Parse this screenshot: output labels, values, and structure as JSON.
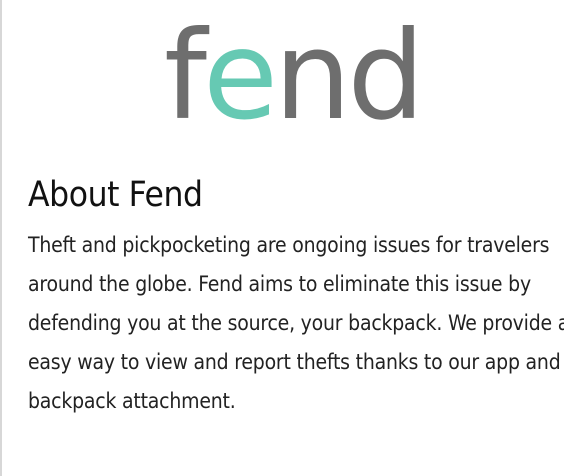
{
  "brand": {
    "logo_text": "fend",
    "logo_colors": {
      "primary": "#6e6e6e",
      "accent": "#66c9b3"
    }
  },
  "about": {
    "title": "About Fend",
    "lines": [
      "Theft and pickpocketing are ongoing issues for travelers",
      "around the globe. Fend aims to eliminate this issue by",
      "defending you at the source, your backpack. We provide an",
      "easy way to view and report thefts thanks to our app and",
      "backpack attachment."
    ]
  }
}
